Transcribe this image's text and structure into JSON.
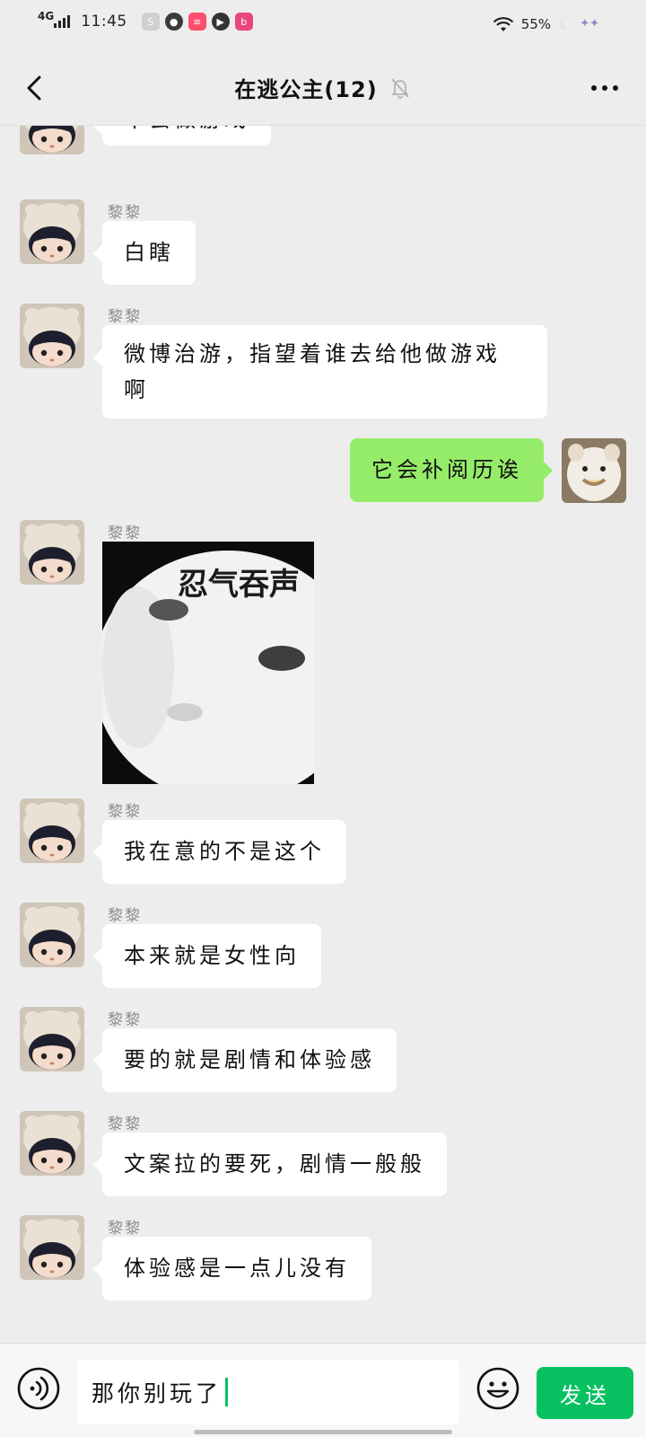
{
  "status_bar": {
    "network": "4G",
    "time": "11:45",
    "battery": "55%",
    "app_icons": [
      "soul-icon",
      "wechat-icon",
      "xiaohongshu-icon",
      "video-icon",
      "bilibili-icon"
    ]
  },
  "header": {
    "title": "在逃公主(12)",
    "muted": true
  },
  "messages": [
    {
      "side": "left",
      "sender": "",
      "text": "不会做游戏"
    },
    {
      "side": "left",
      "sender": "黎黎",
      "text": "白瞎"
    },
    {
      "side": "left",
      "sender": "黎黎",
      "text_line1": "微博治游，指望着谁去给他做游戏",
      "text_line2": "啊"
    },
    {
      "side": "right",
      "text": "它会补阅历诶"
    },
    {
      "side": "left",
      "sender": "黎黎",
      "sticker_text": "忍气吞声"
    },
    {
      "side": "left",
      "sender": "黎黎",
      "text": "我在意的不是这个"
    },
    {
      "side": "left",
      "sender": "黎黎",
      "text": "本来就是女性向"
    },
    {
      "side": "left",
      "sender": "黎黎",
      "text": "要的就是剧情和体验感"
    },
    {
      "side": "left",
      "sender": "黎黎",
      "text": "文案拉的要死，剧情一般般"
    },
    {
      "side": "left",
      "sender": "黎黎",
      "text": "体验感是一点儿没有"
    }
  ],
  "input": {
    "value": "那你别玩了",
    "send_label": "发送"
  },
  "colors": {
    "accent": "#07c160",
    "self_bubble": "#95ec69",
    "background": "#ededed"
  }
}
